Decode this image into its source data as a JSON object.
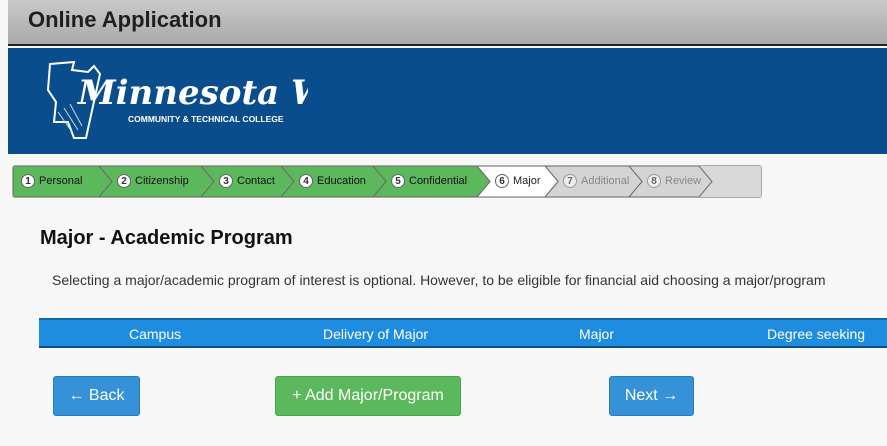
{
  "header": {
    "title": "Online Application"
  },
  "logo": {
    "name": "Minnesota West",
    "subtitle": "COMMUNITY & TECHNICAL COLLEGE"
  },
  "steps": [
    {
      "num": "1",
      "label": "Personal",
      "state": "done"
    },
    {
      "num": "2",
      "label": "Citizenship",
      "state": "done"
    },
    {
      "num": "3",
      "label": "Contact",
      "state": "done"
    },
    {
      "num": "4",
      "label": "Education",
      "state": "done"
    },
    {
      "num": "5",
      "label": "Confidential",
      "state": "done"
    },
    {
      "num": "6",
      "label": "Major",
      "state": "active"
    },
    {
      "num": "7",
      "label": "Additional",
      "state": "pending"
    },
    {
      "num": "8",
      "label": "Review",
      "state": "pending"
    }
  ],
  "main": {
    "heading": "Major - Academic Program",
    "intro": "Selecting a major/academic program of interest is optional. However, to be eligible for financial aid choosing a major/program",
    "columns": [
      "Campus",
      "Delivery of Major",
      "Major",
      "Degree seeking"
    ]
  },
  "buttons": {
    "back": "← Back",
    "add": "+ Add Major/Program",
    "next": "Next →"
  },
  "colors": {
    "banner": "#0a4d8c",
    "step_done": "#5cb85c",
    "step_active": "#ffffff",
    "step_pending": "#d4d4d4",
    "table_header": "#1f8ddf",
    "button_blue": "#3592d8",
    "button_green": "#5cb85c"
  }
}
